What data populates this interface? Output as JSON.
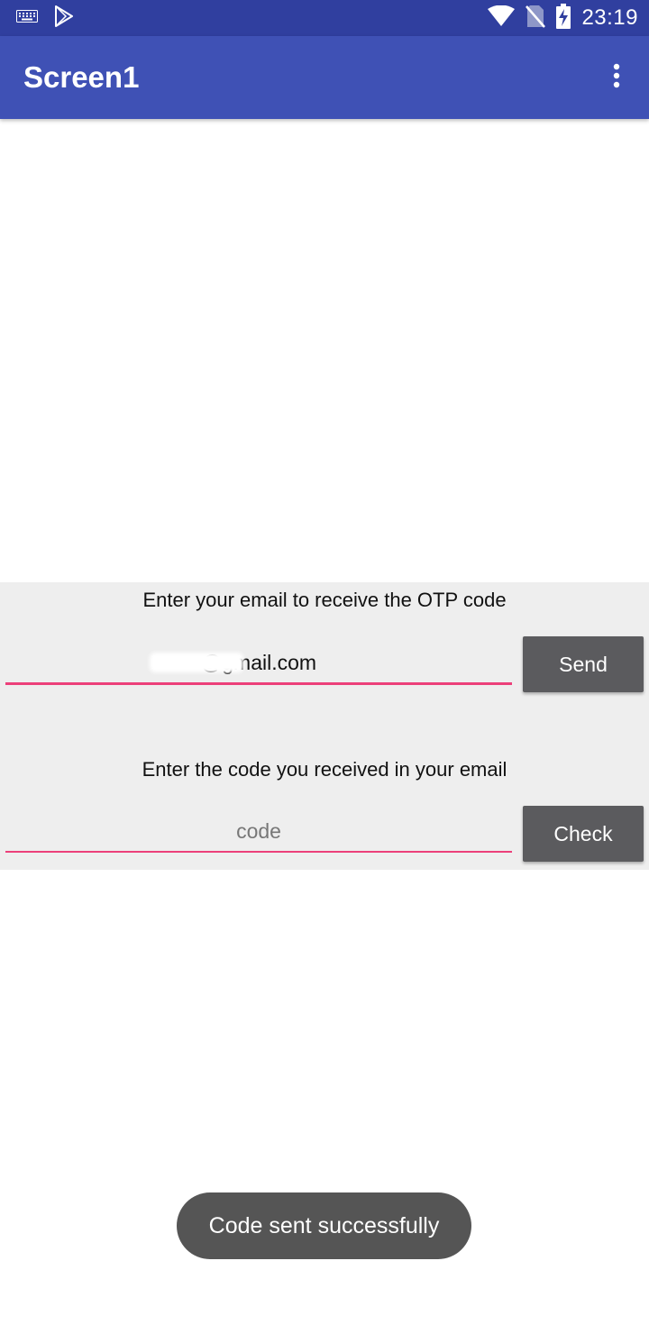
{
  "status_bar": {
    "time": "23:19",
    "icons": [
      "keyboard-icon",
      "play-store-icon",
      "wifi-icon",
      "no-sim-icon",
      "battery-charging-icon"
    ]
  },
  "app_bar": {
    "title": "Screen1",
    "overflow_icon": "more-vert-icon"
  },
  "form": {
    "email_prompt": "Enter your email to receive the OTP code",
    "email_value": "@gmail.com",
    "send_label": "Send",
    "code_prompt": "Enter the code you received in your email",
    "code_placeholder": "code",
    "check_label": "Check"
  },
  "toast": {
    "message": "Code sent successfully"
  },
  "colors": {
    "status_bar": "#303F9F",
    "app_bar": "#3F51B5",
    "panel": "#EEEEEE",
    "field_underline": "#EC407A",
    "button": "#5B5B5E",
    "toast": "#555555"
  }
}
